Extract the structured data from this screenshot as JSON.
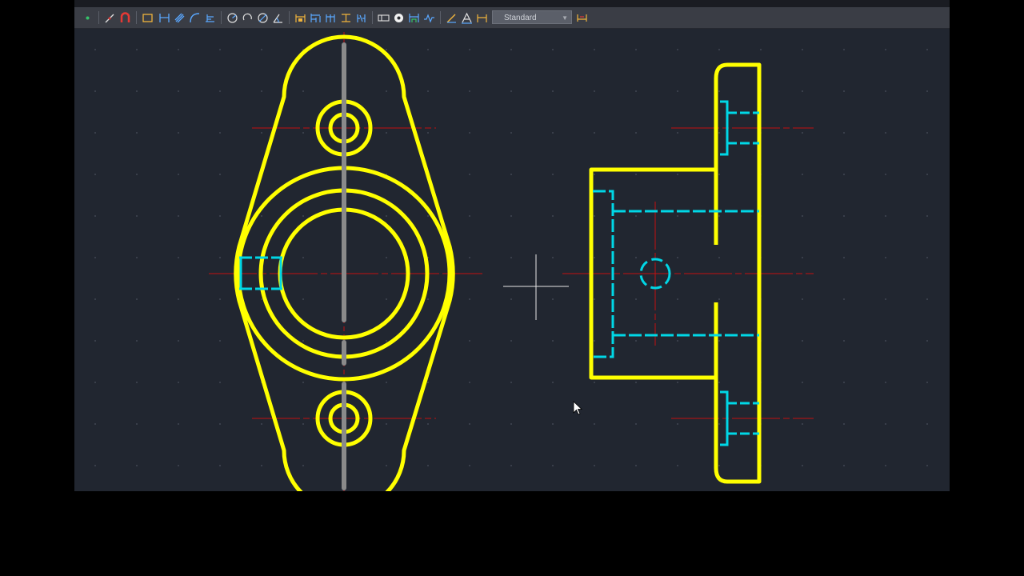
{
  "toolbar": {
    "dimension_style": "Standard",
    "tools_left": [
      "snap-icon",
      "fillet-icon",
      "rectangle-icon"
    ],
    "tools_dim": [
      "linear-dimension-icon",
      "aligned-dimension-icon",
      "arc-length-icon",
      "ordinate-icon"
    ],
    "tools_circle": [
      "radius-icon",
      "jogged-icon",
      "diameter-icon",
      "angular-icon"
    ],
    "tools_misc": [
      "quick-dimension-icon",
      "baseline-icon",
      "continue-icon",
      "space-icon",
      "break-icon",
      "tolerance-icon",
      "center-mark-icon",
      "inspect-icon",
      "jogged-linear-icon",
      "edit-dimension-icon",
      "edit-text-icon",
      "update-icon"
    ],
    "tools_right": [
      "dimension-style-icon"
    ]
  },
  "drawing": {
    "colors": {
      "background": "#212630",
      "object": "#ffff00",
      "hidden": "#00d7e6",
      "center": "#c41010",
      "axis": "#8a8a8a",
      "crosshair": "#e6e6e6",
      "grid_dot": "#4a505c"
    },
    "views": [
      "front-view",
      "side-view"
    ]
  }
}
